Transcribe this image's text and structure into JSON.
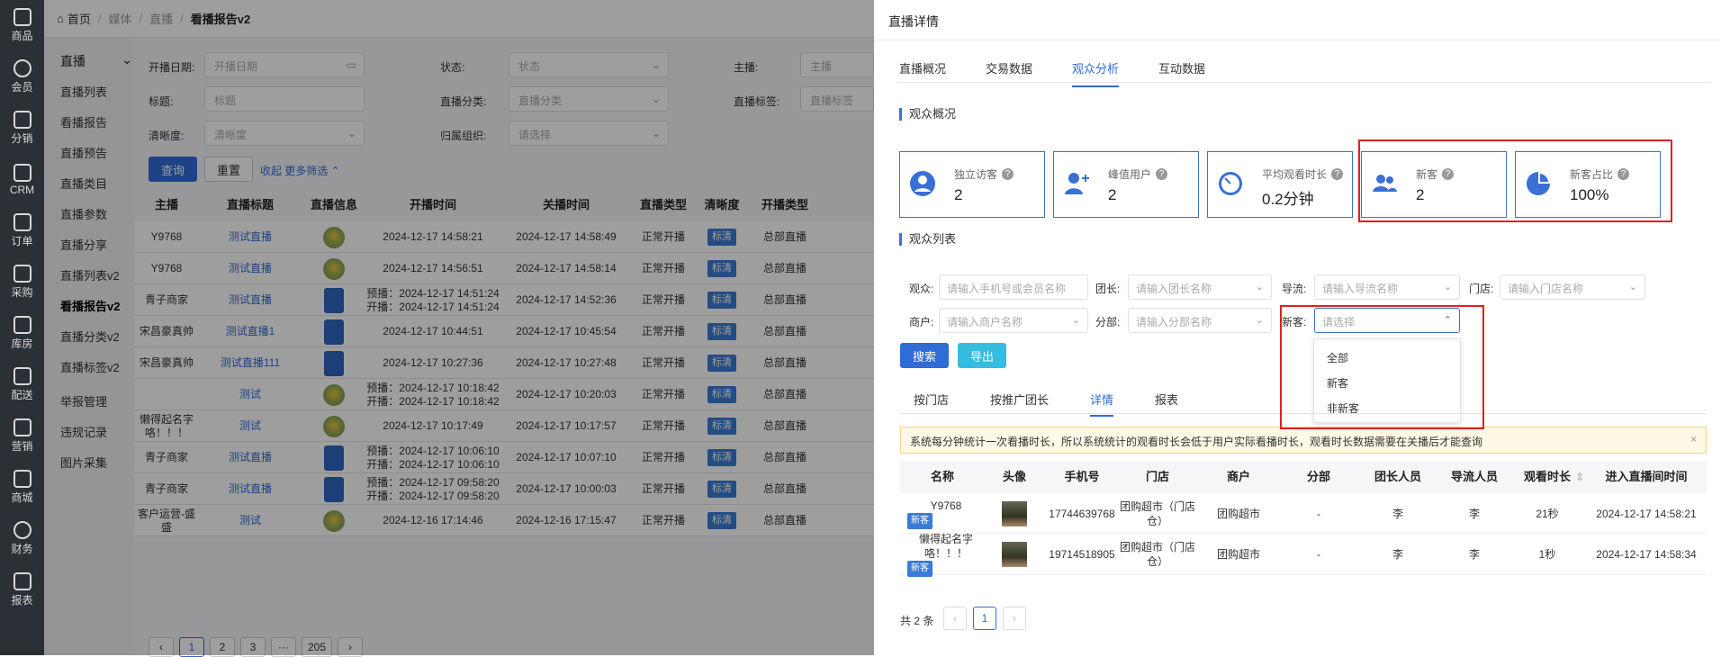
{
  "rail": [
    {
      "label": "商品",
      "icon": "goods-icon"
    },
    {
      "label": "会员",
      "icon": "member-icon"
    },
    {
      "label": "分销",
      "icon": "distribution-icon"
    },
    {
      "label": "CRM",
      "icon": "crm-icon"
    },
    {
      "label": "订单",
      "icon": "order-icon"
    },
    {
      "label": "采购",
      "icon": "purchase-icon"
    },
    {
      "label": "库房",
      "icon": "warehouse-icon"
    },
    {
      "label": "配送",
      "icon": "delivery-icon"
    },
    {
      "label": "营销",
      "icon": "gift-icon"
    },
    {
      "label": "商城",
      "icon": "shop-icon"
    },
    {
      "label": "财务",
      "icon": "yen-icon"
    },
    {
      "label": "报表",
      "icon": "chart-icon"
    }
  ],
  "breadcrumb": {
    "home": "首页",
    "media": "媒体",
    "live": "直播",
    "current": "看播报告v2"
  },
  "subnav": {
    "header": "直播",
    "items": [
      "直播列表",
      "看播报告",
      "直播预告",
      "直播类目",
      "直播参数",
      "直播分享",
      "直播列表v2",
      "看播报告v2",
      "直播分类v2",
      "直播标签v2",
      "举报管理",
      "违规记录",
      "图片采集"
    ]
  },
  "filters": {
    "date_label": "开播日期:",
    "date_ph": "开播日期",
    "status_label": "状态:",
    "status_ph": "状态",
    "anchor_label": "主播:",
    "anchor_ph": "主播",
    "title_label": "标题:",
    "title_ph": "标题",
    "cat_label": "直播分类:",
    "cat_ph": "直播分类",
    "tag_label": "直播标签:",
    "tag_ph": "直播标签",
    "def_label": "清晰度:",
    "def_ph": "清晰度",
    "org_label": "归属组织:",
    "org_ph": "请选择",
    "query": "查询",
    "reset": "重置",
    "collapse": "收起 更多筛选"
  },
  "table": {
    "headers": [
      "主播",
      "直播标题",
      "直播信息",
      "开播时间",
      "关播时间",
      "直播类型",
      "清晰度",
      "开播类型"
    ],
    "rows": [
      {
        "anchor": "Y9768",
        "title": "测试直播",
        "thumb": "a",
        "start": "2024-12-17 14:58:21",
        "start2": "",
        "end": "2024-12-17 14:58:49",
        "type": "正常开播",
        "def": "标清",
        "mode": "总部直播"
      },
      {
        "anchor": "Y9768",
        "title": "测试直播",
        "thumb": "a",
        "start": "2024-12-17 14:56:51",
        "start2": "",
        "end": "2024-12-17 14:58:14",
        "type": "正常开播",
        "def": "标清",
        "mode": "总部直播"
      },
      {
        "anchor": "青子商家",
        "title": "测试直播",
        "thumb": "b",
        "start": "预播：2024-12-17 14:51:24",
        "start2": "开播：2024-12-17 14:51:24",
        "end": "2024-12-17 14:52:36",
        "type": "正常开播",
        "def": "标清",
        "mode": "总部直播"
      },
      {
        "anchor": "宋昌豪真帅",
        "title": "测试直播1",
        "thumb": "b",
        "start": "2024-12-17 10:44:51",
        "start2": "",
        "end": "2024-12-17 10:45:54",
        "type": "正常开播",
        "def": "标清",
        "mode": "总部直播"
      },
      {
        "anchor": "宋昌豪真帅",
        "title": "测试直播111",
        "thumb": "b",
        "start": "2024-12-17 10:27:36",
        "start2": "",
        "end": "2024-12-17 10:27:48",
        "type": "正常开播",
        "def": "标清",
        "mode": "总部直播"
      },
      {
        "anchor": "",
        "title": "测试",
        "thumb": "a",
        "start": "预播：2024-12-17 10:18:42",
        "start2": "开播：2024-12-17 10:18:42",
        "end": "2024-12-17 10:20:03",
        "type": "正常开播",
        "def": "标清",
        "mode": "总部直播"
      },
      {
        "anchor": "懒得起名字",
        "anchor2": "咯！！！",
        "title": "测试",
        "thumb": "a",
        "start": "2024-12-17 10:17:49",
        "start2": "",
        "end": "2024-12-17 10:17:57",
        "type": "正常开播",
        "def": "标清",
        "mode": "总部直播"
      },
      {
        "anchor": "青子商家",
        "title": "测试直播",
        "thumb": "b",
        "start": "预播：2024-12-17 10:06:10",
        "start2": "开播：2024-12-17 10:06:10",
        "end": "2024-12-17 10:07:10",
        "type": "正常开播",
        "def": "标清",
        "mode": "总部直播"
      },
      {
        "anchor": "青子商家",
        "title": "测试直播",
        "thumb": "b",
        "start": "预播：2024-12-17 09:58:20",
        "start2": "开播：2024-12-17 09:58:20",
        "end": "2024-12-17 10:00:03",
        "type": "正常开播",
        "def": "标清",
        "mode": "总部直播"
      },
      {
        "anchor": "客户运营-盛",
        "anchor2": "盛",
        "title": "测试",
        "thumb": "a",
        "start": "2024-12-16 17:14:46",
        "start2": "",
        "end": "2024-12-16 17:15:47",
        "type": "正常开播",
        "def": "标清",
        "mode": "总部直播"
      }
    ]
  },
  "pager": [
    "‹",
    "1",
    "2",
    "3",
    "···",
    "205",
    "›"
  ],
  "drawer": {
    "title": "直播详情",
    "tabs": [
      "直播概况",
      "交易数据",
      "观众分析",
      "互动数据"
    ],
    "active_tab": 2,
    "overview_title": "观众概况",
    "cards": [
      {
        "label": "独立访客",
        "value": "2",
        "icon": "user-circle-icon"
      },
      {
        "label": "峰值用户",
        "value": "2",
        "icon": "user-plus-icon"
      },
      {
        "label": "平均观看时长",
        "value": "0.2分钟",
        "icon": "clock-icon"
      },
      {
        "label": "新客",
        "value": "2",
        "icon": "users-icon"
      },
      {
        "label": "新客占比",
        "value": "100%",
        "icon": "pie-icon"
      }
    ],
    "list_title": "观众列表",
    "audience_label": "观众:",
    "audience_ph": "请输入手机号或会员名称",
    "leader_label": "团长:",
    "leader_ph": "请输入团长名称",
    "guide_label": "导流:",
    "guide_ph": "请输入导流名称",
    "store_label": "门店:",
    "store_ph": "请输入门店名称",
    "merchant_label": "商户:",
    "merchant_ph": "请输入商户名称",
    "branch_label": "分部:",
    "branch_ph": "请输入分部名称",
    "newcust_label": "新客:",
    "newcust_ph": "请选择",
    "search": "搜索",
    "export": "导出",
    "dropdown": [
      "全部",
      "新客",
      "非新客"
    ],
    "subtabs": [
      "按门店",
      "按推广团长",
      "详情",
      "报表"
    ],
    "active_subtab": 2,
    "notice": "系统每分钟统计一次看播时长，所以系统统计的观看时长会低于用户实际看播时长，观看时长数据需要在关播后才能查询",
    "headers": [
      "名称",
      "头像",
      "手机号",
      "门店",
      "商户",
      "分部",
      "团长人员",
      "导流人员",
      "观看时长",
      "进入直播间时间"
    ],
    "rows": [
      {
        "name": "Y9768",
        "name2": "",
        "tag": "新客",
        "phone": "17744639768",
        "store": "团购超市（门店",
        "store2": "仓）",
        "merchant": "团购超市",
        "branch": "-",
        "leader": "李",
        "guide": "李",
        "dur": "21秒",
        "enter": "2024-12-17 14:58:21"
      },
      {
        "name": "懒得起名字",
        "name2": "咯！！！",
        "tag": "新客",
        "phone": "19714518905",
        "store": "团购超市（门店",
        "store2": "仓）",
        "merchant": "团购超市",
        "branch": "-",
        "leader": "李",
        "guide": "李",
        "dur": "1秒",
        "enter": "2024-12-17 14:58:34"
      }
    ],
    "total": "共 2 条",
    "page": "1"
  }
}
